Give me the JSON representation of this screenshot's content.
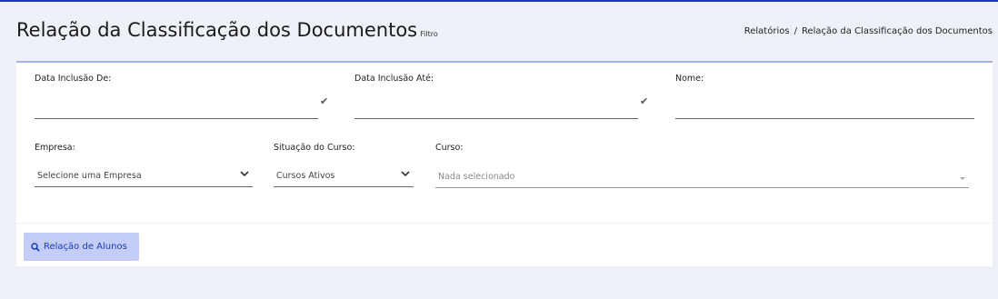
{
  "header": {
    "title": "Relação da Classificação dos Documentos",
    "subtitle": "Filtro",
    "breadcrumb": {
      "item1": "Relatórios",
      "separator": "/",
      "item2": "Relação da Classificação dos Documentos"
    }
  },
  "filters": {
    "date_from_label": "Data Inclusão De:",
    "date_to_label": "Data Inclusão Até:",
    "name_label": "Nome:",
    "company_label": "Empresa:",
    "company_value": "Selecione uma Empresa",
    "course_status_label": "Situação do Curso:",
    "course_status_value": "Cursos Ativos",
    "course_label": "Curso:",
    "course_placeholder": "Nada selecionado",
    "check_glyph": "✔"
  },
  "actions": {
    "report_button_label": "Relação de Alunos",
    "report_button_icon": "search-icon"
  },
  "colors": {
    "accent": "#1e3bb3",
    "button_bg": "#c3cdf7",
    "page_bg": "#eff1f9"
  }
}
